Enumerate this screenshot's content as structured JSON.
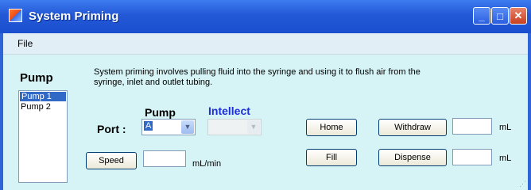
{
  "window": {
    "title": "System Priming",
    "controls": {
      "minimize": "_",
      "maximize": "□",
      "close": "✕"
    }
  },
  "menu": {
    "file": "File"
  },
  "pump_panel": {
    "heading": "Pump",
    "items": [
      {
        "label": "Pump 1",
        "selected": true
      },
      {
        "label": "Pump 2",
        "selected": false
      }
    ]
  },
  "description": "System priming involves pulling fluid into the syringe and using it to flush air from the syringe, inlet and outlet tubing.",
  "columns": {
    "pump": "Pump",
    "intellect": "Intellect"
  },
  "port": {
    "label": "Port :",
    "pump_value": "A",
    "intellect_value": ""
  },
  "speed": {
    "button": "Speed",
    "value": "",
    "unit": "mL/min"
  },
  "actions": {
    "home": "Home",
    "fill": "Fill",
    "withdraw": "Withdraw",
    "dispense": "Dispense"
  },
  "volumes": {
    "withdraw_value": "",
    "withdraw_unit": "mL",
    "dispense_value": "",
    "dispense_unit": "mL"
  },
  "colors": {
    "titlebar": "#2358d6",
    "client_bg": "#d6f3f6",
    "intellect_text": "#1f2fd6",
    "selection": "#3169c6"
  }
}
